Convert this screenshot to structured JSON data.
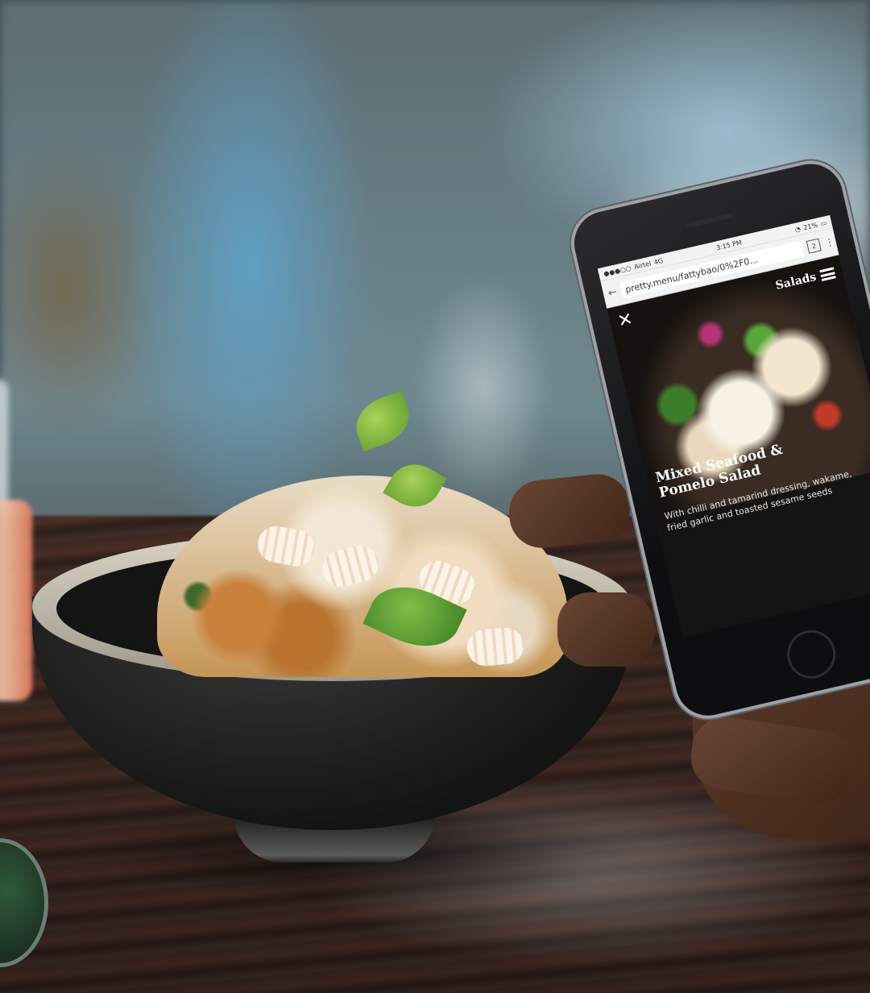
{
  "status_bar": {
    "carrier": "Airtel",
    "network": "4G",
    "time": "3:15 PM",
    "battery": "21%"
  },
  "browser": {
    "url": "pretty.menu/fattybao/0%2F0...",
    "tab_count": "2",
    "back_icon": "back-arrow-icon",
    "menu_icon": "kebab-menu-icon"
  },
  "menu_page": {
    "section": "Salads",
    "close_icon": "close-icon",
    "nav_icon": "hamburger-icon",
    "dish": {
      "name_line1": "Mixed Seafood &",
      "name_line2": "Pomelo Salad",
      "description_line1": "With chilli and tamarind dressing, wakame,",
      "description_line2": "fried garlic and toasted sesame seeds"
    }
  },
  "colors": {
    "menu_background": "#141414",
    "menu_text": "#ffffff",
    "browser_chrome": "#f2f2f2"
  }
}
